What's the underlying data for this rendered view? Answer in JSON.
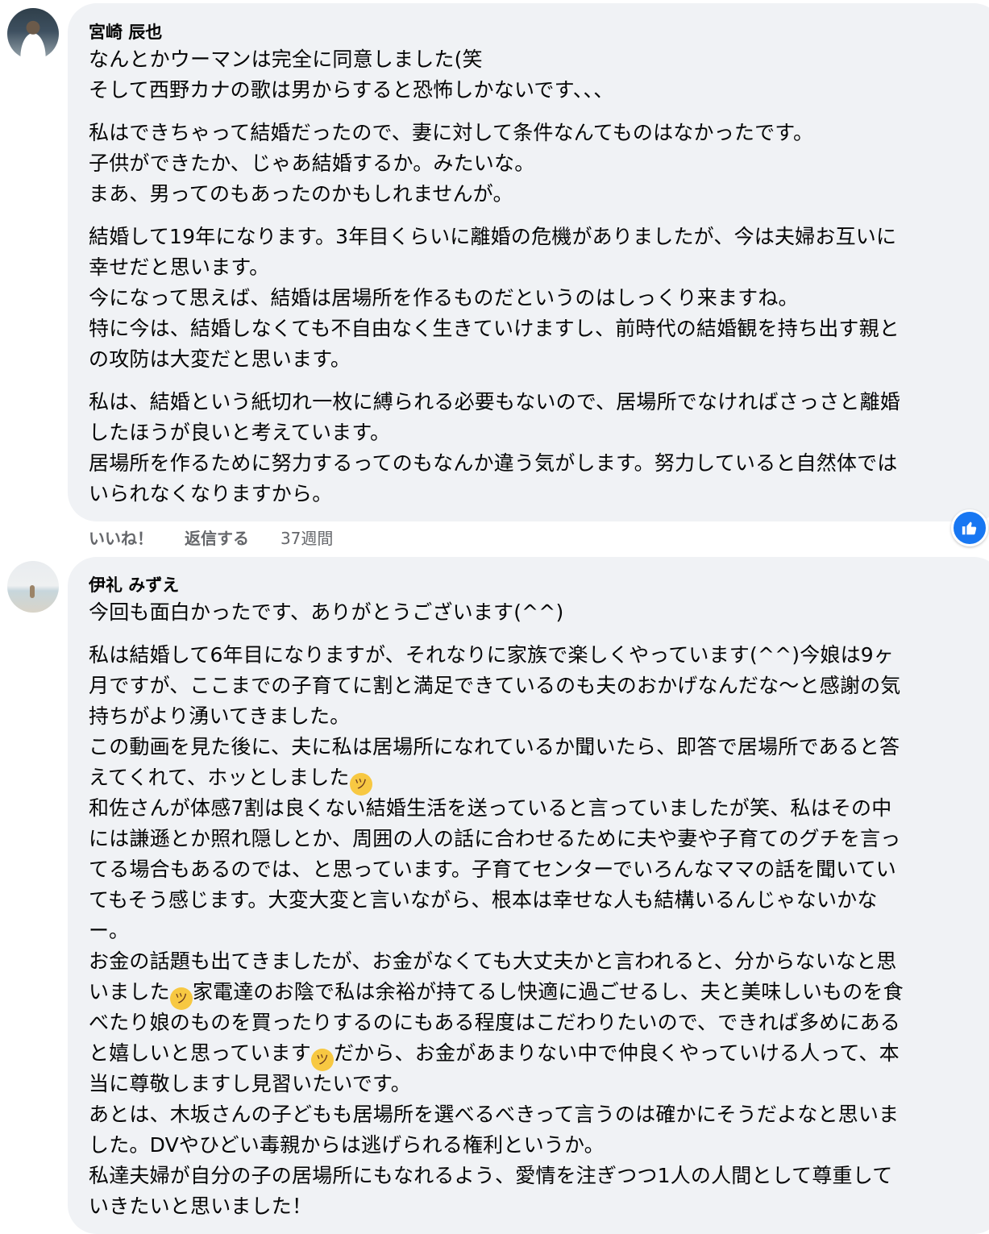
{
  "comments": [
    {
      "author": "宮崎 辰也",
      "lines": [
        "なんとかウーマンは完全に同意しました(笑",
        "そして西野カナの歌は男からすると恐怖しかないです、、、",
        "私はできちゃって結婚だったので、妻に対して条件なんてものはなかったです。",
        "子供ができたか、じゃあ結婚するか。みたいな。",
        "まあ、男ってのもあったのかもしれませんが。",
        "結婚して19年になります。3年目くらいに離婚の危機がありましたが、今は夫婦お互いに",
        "幸せだと思います。",
        "今になって思えば、結婚は居場所を作るものだというのはしっくり来ますね。",
        "特に今は、結婚しなくても不自由なく生きていけますし、前時代の結婚観を持ち出す親と",
        "の攻防は大変だと思います。",
        "私は、結婚という紙切れ一枚に縛られる必要もないので、居場所でなければさっさと離婚",
        "したほうが良いと考えています。",
        "居場所を作るために努力するってのもなんか違う気がします。努力していると自然体では",
        "いられなくなりますから。"
      ],
      "actions": {
        "like": "いいね！",
        "reply": "返信する",
        "time": "37週間"
      },
      "reaction_icon": "thumbs-up-icon"
    },
    {
      "author": "伊礼 みずえ",
      "lines": [
        "今回も面白かったです、ありがとうございます(^^)",
        "私は結婚して6年目になりますが、それなりに家族で楽しくやっています(^^)今娘は9ヶ",
        "月ですが、ここまでの子育てに割と満足できているのも夫のおかげなんだな〜と感謝の気",
        "持ちがより湧いてきました。",
        "この動画を見た後に、夫に私は居場所になれているか聞いたら、即答で居場所であると答",
        "えてくれて、ホッとしました",
        "和佐さんが体感7割は良くない結婚生活を送っていると言っていましたが笑、私はその中",
        "には謙遜とか照れ隠しとか、周囲の人の話に合わせるために夫や妻や子育てのグチを言っ",
        "てる場合もあるのでは、と思っています。子育てセンターでいろんなママの話を聞いてい",
        "てもそう感じます。大変大変と言いながら、根本は幸せな人も結構いるんじゃないかな",
        "ー。",
        "お金の話題も出てきましたが、お金がなくても大丈夫かと言われると、分からないなと思",
        "いました",
        "家電達のお陰で私は余裕が持てるし快適に過ごせるし、夫と美味しいものを食",
        "べたり娘のものを買ったりするのにもある程度はこだわりたいので、できれば多めにある",
        "と嬉しいと思っています",
        "だから、お金があまりない中で仲良くやっていける人って、本",
        "当に尊敬しますし見習いたいです。",
        "あとは、木坂さんの子どもも居場所を選べるべきって言うのは確かにそうだよなと思いま",
        "した。DVやひどい毒親からは逃げられる権利というか。",
        "私達夫婦が自分の子の居場所にもなれるよう、愛情を注ぎつつ1人の人間として尊重して",
        "いきたいと思いました！"
      ],
      "emojis": [
        "grinning-face-emoji",
        "sweat-smile-emoji",
        "grinning-face-emoji"
      ]
    }
  ]
}
